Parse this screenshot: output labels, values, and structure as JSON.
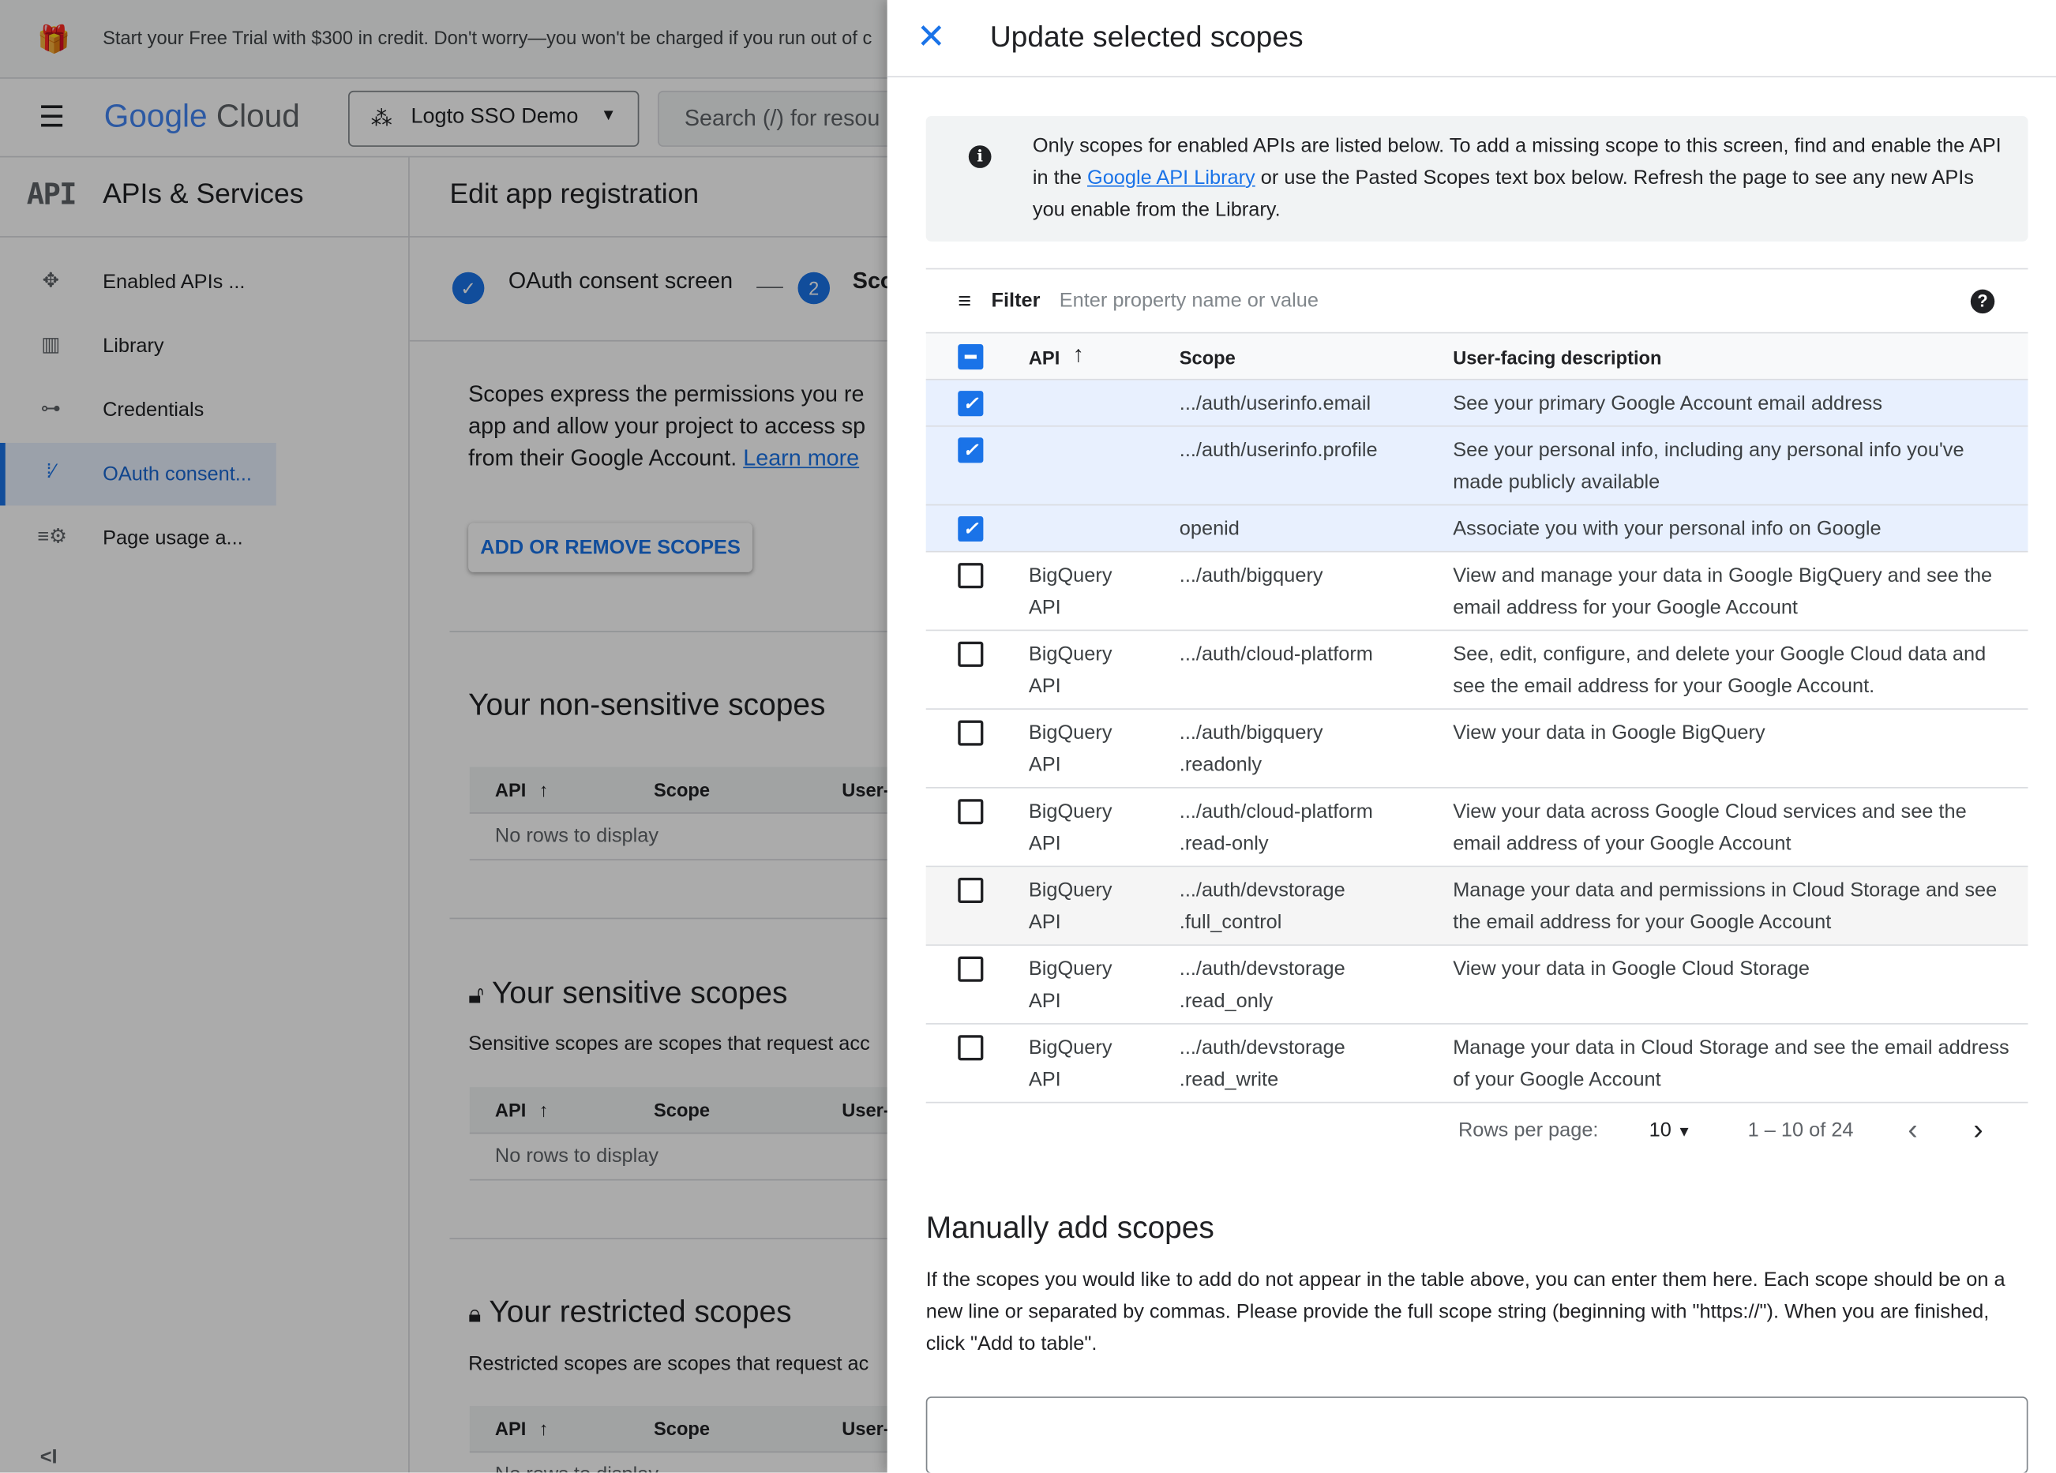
{
  "banner": {
    "icon": "gift-icon",
    "text": "Start your Free Trial with $300 in credit. Don't worry—you won't be charged if you run out of c"
  },
  "header": {
    "logo_google": "Google",
    "logo_cloud": "Cloud",
    "project": "Logto SSO Demo",
    "search_placeholder": "Search (/) for resou"
  },
  "sidebar": {
    "title": "APIs & Services",
    "logo": "API",
    "items": [
      {
        "label": "Enabled APIs ...",
        "icon": "enabled-apis-icon"
      },
      {
        "label": "Library",
        "icon": "library-icon"
      },
      {
        "label": "Credentials",
        "icon": "key-icon"
      },
      {
        "label": "OAuth consent...",
        "icon": "oauth-consent-icon",
        "selected": true
      },
      {
        "label": "Page usage a...",
        "icon": "page-usage-icon"
      }
    ],
    "collapse": "<I"
  },
  "main": {
    "title": "Edit app registration",
    "steps": [
      {
        "label": "OAuth consent screen",
        "state": "done"
      },
      {
        "number": "2",
        "label": "Sco"
      }
    ],
    "intro": [
      "Scopes express the permissions you re",
      "app and allow your project to access sp",
      "from their Google Account."
    ],
    "learn_more": "Learn more",
    "add_remove_button": "ADD OR REMOVE SCOPES",
    "nonsensitive_title": "Your non-sensitive scopes",
    "sensitive_title": "Your sensitive scopes",
    "sensitive_desc": "Sensitive scopes are scopes that request acc",
    "restricted_title": "Your restricted scopes",
    "restricted_desc": "Restricted scopes are scopes that request ac",
    "col_api": "API",
    "col_scope": "Scope",
    "col_user": "User-",
    "no_rows": "No rows to display"
  },
  "panel": {
    "title": "Update selected scopes",
    "info_pre": "Only scopes for enabled APIs are listed below. To add a missing scope to this screen, find and enable the API in the ",
    "info_link": "Google API Library",
    "info_post": " or use the Pasted Scopes text box below. Refresh the page to see any new APIs you enable from the Library.",
    "filter_label": "Filter",
    "filter_placeholder": "Enter property name or value",
    "columns": {
      "api": "API",
      "scope": "Scope",
      "description": "User-facing description"
    },
    "rows": [
      {
        "checked": true,
        "api": "",
        "scope": ".../auth/userinfo.email",
        "description": "See your primary Google Account email address"
      },
      {
        "checked": true,
        "api": "",
        "scope": ".../auth/userinfo.profile",
        "description": "See your personal info, including any personal info you've made publicly available"
      },
      {
        "checked": true,
        "api": "",
        "scope": "openid",
        "description": "Associate you with your personal info on Google"
      },
      {
        "checked": false,
        "api": "BigQuery API",
        "scope": ".../auth/bigquery",
        "description": "View and manage your data in Google BigQuery and see the email address for your Google Account"
      },
      {
        "checked": false,
        "api": "BigQuery API",
        "scope": ".../auth/cloud-platform",
        "description": "See, edit, configure, and delete your Google Cloud data and see the email address for your Google Account."
      },
      {
        "checked": false,
        "api": "BigQuery API",
        "scope": ".../auth/bigquery .readonly",
        "description": "View your data in Google BigQuery"
      },
      {
        "checked": false,
        "api": "BigQuery API",
        "scope": ".../auth/cloud-platform .read-only",
        "description": "View your data across Google Cloud services and see the email address of your Google Account"
      },
      {
        "checked": false,
        "api": "BigQuery API",
        "scope": ".../auth/devstorage .full_control",
        "description": "Manage your data and permissions in Cloud Storage and see the email address for your Google Account"
      },
      {
        "checked": false,
        "api": "BigQuery API",
        "scope": ".../auth/devstorage .read_only",
        "description": "View your data in Google Cloud Storage"
      },
      {
        "checked": false,
        "api": "BigQuery API",
        "scope": ".../auth/devstorage .read_write",
        "description": "Manage your data in Cloud Storage and see the email address of your Google Account"
      }
    ],
    "rows_per_page_label": "Rows per page:",
    "rows_per_page": "10",
    "range": "1 – 10 of 24",
    "manual_title": "Manually add scopes",
    "manual_desc": "If the scopes you would like to add do not appear in the table above, you can enter them here. Each scope should be on a new line or separated by commas. Please provide the full scope string (beginning with \"https://\"). When you are finished, click \"Add to table\".",
    "manual_value": ""
  },
  "colors": {
    "accent": "#1a73e8",
    "selected_row": "#e8f0fe"
  }
}
